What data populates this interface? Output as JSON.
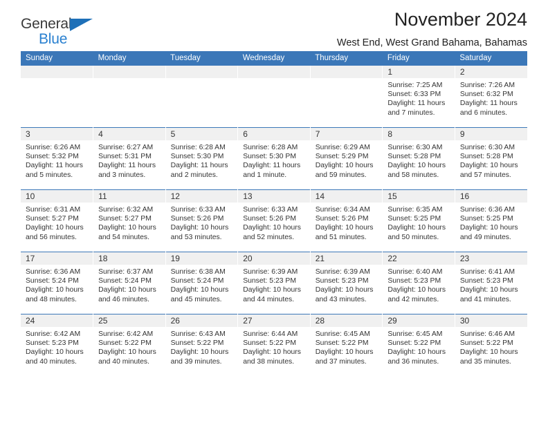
{
  "brand": {
    "name_top": "General",
    "name_bottom": "Blue",
    "accent_color": "#2980d0",
    "triangle_color": "#1e70b8"
  },
  "header": {
    "title": "November 2024",
    "subtitle": "West End, West Grand Bahama, Bahamas"
  },
  "calendar": {
    "header_bg": "#3b77b8",
    "daybar_bg": "#f0f0f0",
    "weekday_headers": [
      "Sunday",
      "Monday",
      "Tuesday",
      "Wednesday",
      "Thursday",
      "Friday",
      "Saturday"
    ],
    "weeks": [
      [
        {
          "date": "",
          "lines": []
        },
        {
          "date": "",
          "lines": []
        },
        {
          "date": "",
          "lines": []
        },
        {
          "date": "",
          "lines": []
        },
        {
          "date": "",
          "lines": []
        },
        {
          "date": "1",
          "lines": [
            "Sunrise: 7:25 AM",
            "Sunset: 6:33 PM",
            "Daylight: 11 hours",
            "and 7 minutes."
          ]
        },
        {
          "date": "2",
          "lines": [
            "Sunrise: 7:26 AM",
            "Sunset: 6:32 PM",
            "Daylight: 11 hours",
            "and 6 minutes."
          ]
        }
      ],
      [
        {
          "date": "3",
          "lines": [
            "Sunrise: 6:26 AM",
            "Sunset: 5:32 PM",
            "Daylight: 11 hours",
            "and 5 minutes."
          ]
        },
        {
          "date": "4",
          "lines": [
            "Sunrise: 6:27 AM",
            "Sunset: 5:31 PM",
            "Daylight: 11 hours",
            "and 3 minutes."
          ]
        },
        {
          "date": "5",
          "lines": [
            "Sunrise: 6:28 AM",
            "Sunset: 5:30 PM",
            "Daylight: 11 hours",
            "and 2 minutes."
          ]
        },
        {
          "date": "6",
          "lines": [
            "Sunrise: 6:28 AM",
            "Sunset: 5:30 PM",
            "Daylight: 11 hours",
            "and 1 minute."
          ]
        },
        {
          "date": "7",
          "lines": [
            "Sunrise: 6:29 AM",
            "Sunset: 5:29 PM",
            "Daylight: 10 hours",
            "and 59 minutes."
          ]
        },
        {
          "date": "8",
          "lines": [
            "Sunrise: 6:30 AM",
            "Sunset: 5:28 PM",
            "Daylight: 10 hours",
            "and 58 minutes."
          ]
        },
        {
          "date": "9",
          "lines": [
            "Sunrise: 6:30 AM",
            "Sunset: 5:28 PM",
            "Daylight: 10 hours",
            "and 57 minutes."
          ]
        }
      ],
      [
        {
          "date": "10",
          "lines": [
            "Sunrise: 6:31 AM",
            "Sunset: 5:27 PM",
            "Daylight: 10 hours",
            "and 56 minutes."
          ]
        },
        {
          "date": "11",
          "lines": [
            "Sunrise: 6:32 AM",
            "Sunset: 5:27 PM",
            "Daylight: 10 hours",
            "and 54 minutes."
          ]
        },
        {
          "date": "12",
          "lines": [
            "Sunrise: 6:33 AM",
            "Sunset: 5:26 PM",
            "Daylight: 10 hours",
            "and 53 minutes."
          ]
        },
        {
          "date": "13",
          "lines": [
            "Sunrise: 6:33 AM",
            "Sunset: 5:26 PM",
            "Daylight: 10 hours",
            "and 52 minutes."
          ]
        },
        {
          "date": "14",
          "lines": [
            "Sunrise: 6:34 AM",
            "Sunset: 5:26 PM",
            "Daylight: 10 hours",
            "and 51 minutes."
          ]
        },
        {
          "date": "15",
          "lines": [
            "Sunrise: 6:35 AM",
            "Sunset: 5:25 PM",
            "Daylight: 10 hours",
            "and 50 minutes."
          ]
        },
        {
          "date": "16",
          "lines": [
            "Sunrise: 6:36 AM",
            "Sunset: 5:25 PM",
            "Daylight: 10 hours",
            "and 49 minutes."
          ]
        }
      ],
      [
        {
          "date": "17",
          "lines": [
            "Sunrise: 6:36 AM",
            "Sunset: 5:24 PM",
            "Daylight: 10 hours",
            "and 48 minutes."
          ]
        },
        {
          "date": "18",
          "lines": [
            "Sunrise: 6:37 AM",
            "Sunset: 5:24 PM",
            "Daylight: 10 hours",
            "and 46 minutes."
          ]
        },
        {
          "date": "19",
          "lines": [
            "Sunrise: 6:38 AM",
            "Sunset: 5:24 PM",
            "Daylight: 10 hours",
            "and 45 minutes."
          ]
        },
        {
          "date": "20",
          "lines": [
            "Sunrise: 6:39 AM",
            "Sunset: 5:23 PM",
            "Daylight: 10 hours",
            "and 44 minutes."
          ]
        },
        {
          "date": "21",
          "lines": [
            "Sunrise: 6:39 AM",
            "Sunset: 5:23 PM",
            "Daylight: 10 hours",
            "and 43 minutes."
          ]
        },
        {
          "date": "22",
          "lines": [
            "Sunrise: 6:40 AM",
            "Sunset: 5:23 PM",
            "Daylight: 10 hours",
            "and 42 minutes."
          ]
        },
        {
          "date": "23",
          "lines": [
            "Sunrise: 6:41 AM",
            "Sunset: 5:23 PM",
            "Daylight: 10 hours",
            "and 41 minutes."
          ]
        }
      ],
      [
        {
          "date": "24",
          "lines": [
            "Sunrise: 6:42 AM",
            "Sunset: 5:23 PM",
            "Daylight: 10 hours",
            "and 40 minutes."
          ]
        },
        {
          "date": "25",
          "lines": [
            "Sunrise: 6:42 AM",
            "Sunset: 5:22 PM",
            "Daylight: 10 hours",
            "and 40 minutes."
          ]
        },
        {
          "date": "26",
          "lines": [
            "Sunrise: 6:43 AM",
            "Sunset: 5:22 PM",
            "Daylight: 10 hours",
            "and 39 minutes."
          ]
        },
        {
          "date": "27",
          "lines": [
            "Sunrise: 6:44 AM",
            "Sunset: 5:22 PM",
            "Daylight: 10 hours",
            "and 38 minutes."
          ]
        },
        {
          "date": "28",
          "lines": [
            "Sunrise: 6:45 AM",
            "Sunset: 5:22 PM",
            "Daylight: 10 hours",
            "and 37 minutes."
          ]
        },
        {
          "date": "29",
          "lines": [
            "Sunrise: 6:45 AM",
            "Sunset: 5:22 PM",
            "Daylight: 10 hours",
            "and 36 minutes."
          ]
        },
        {
          "date": "30",
          "lines": [
            "Sunrise: 6:46 AM",
            "Sunset: 5:22 PM",
            "Daylight: 10 hours",
            "and 35 minutes."
          ]
        }
      ]
    ]
  }
}
